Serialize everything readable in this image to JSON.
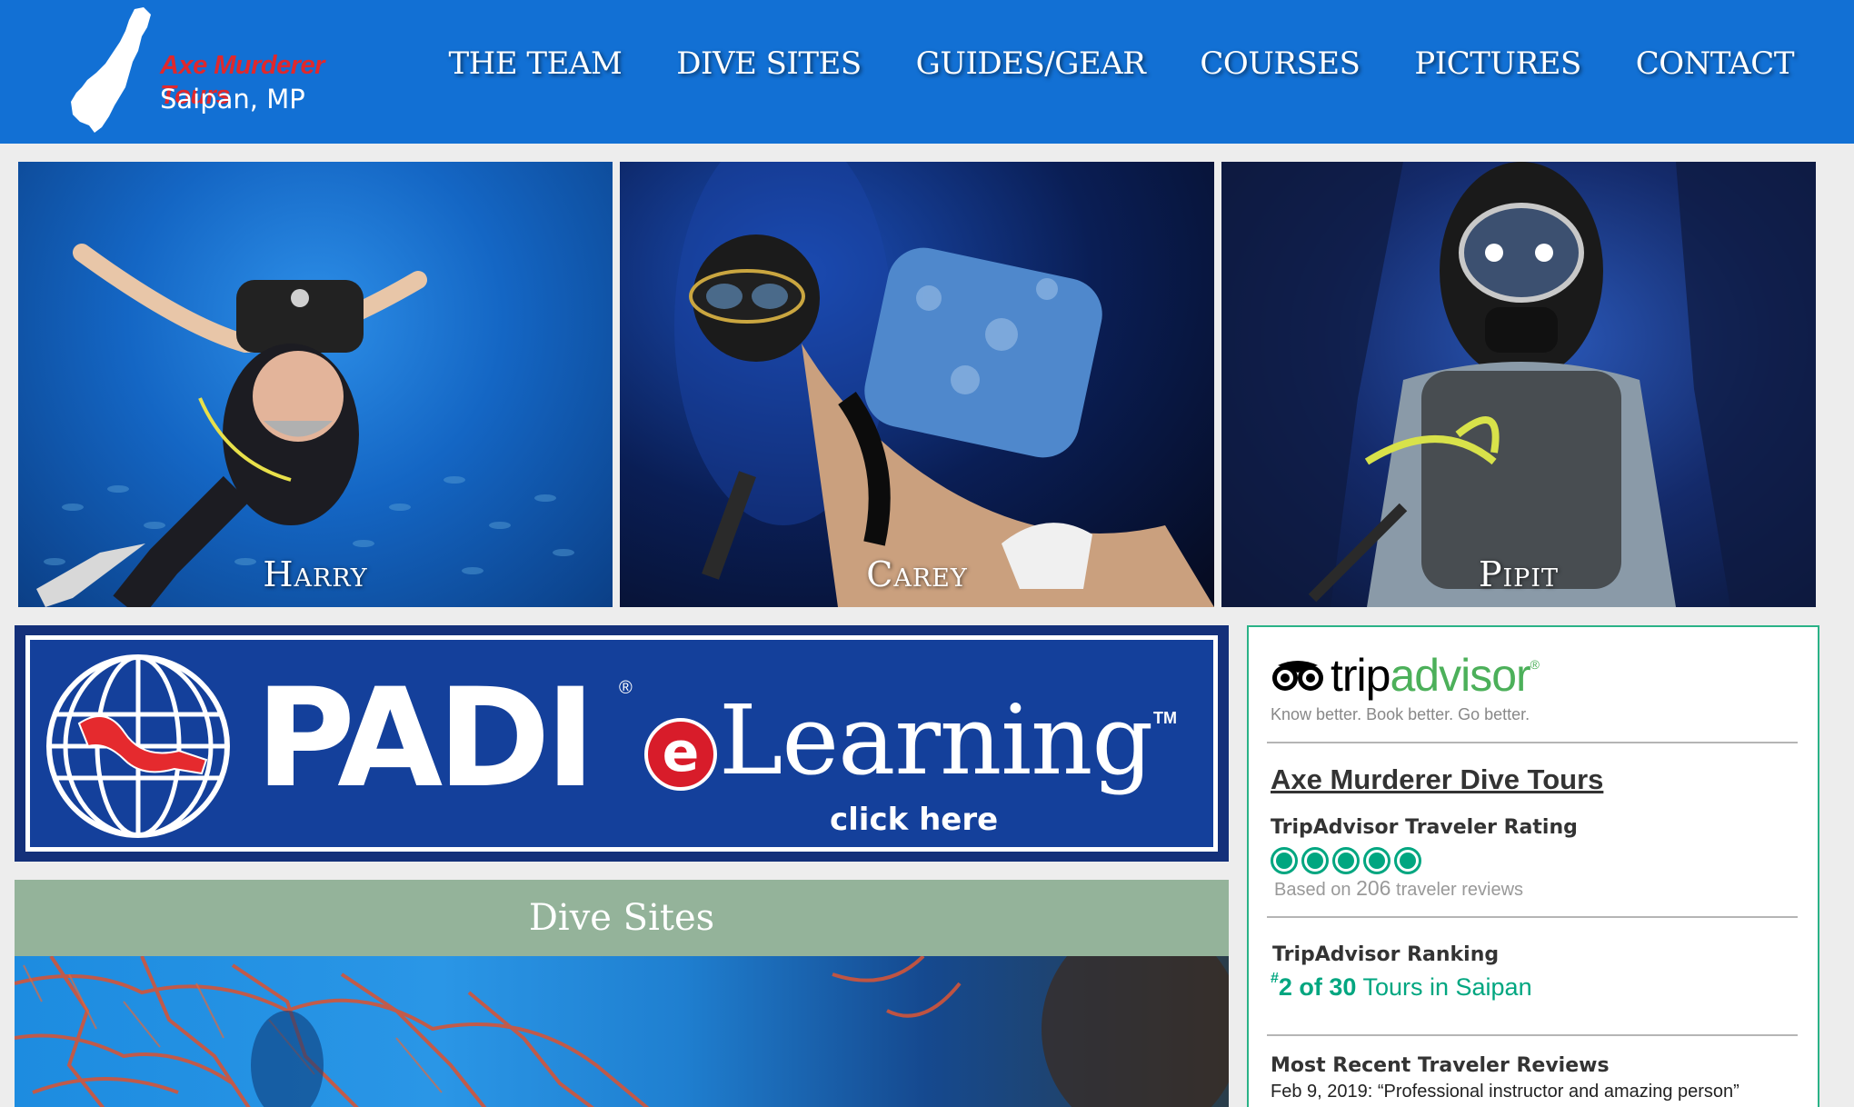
{
  "brand": {
    "name": "Axe Murderer Tours",
    "location": "Saipan, MP",
    "logo_icon": "saipan-island-icon"
  },
  "nav": {
    "items": [
      {
        "label": "THE TEAM"
      },
      {
        "label": "DIVE SITES"
      },
      {
        "label": "GUIDES/GEAR"
      },
      {
        "label": "COURSES"
      },
      {
        "label": "PICTURES"
      },
      {
        "label": "CONTACT"
      }
    ]
  },
  "team": [
    {
      "name": "Harry"
    },
    {
      "name": "Carey"
    },
    {
      "name": "Pipit"
    }
  ],
  "padi_banner": {
    "brand": "PADI",
    "registered": "®",
    "e_letter": "e",
    "product": "Learning",
    "trademark": "TM",
    "cta": "click here"
  },
  "dive_sites": {
    "title": "Dive Sites"
  },
  "tripadvisor": {
    "wordmark_trip": "trip",
    "wordmark_advisor": "advisor",
    "registered": "®",
    "tagline": "Know better. Book better. Go better.",
    "business_name": "Axe Murderer Dive Tours",
    "rating_label": "TripAdvisor Traveler Rating",
    "rating": 5,
    "rating_max": 5,
    "reviews_prefix": "Based on",
    "reviews_count": "206",
    "reviews_suffix": "traveler reviews",
    "ranking_label": "TripAdvisor Ranking",
    "ranking_hash": "#",
    "ranking_value": "2 of 30",
    "ranking_suffix": "Tours in Saipan",
    "recent_label": "Most Recent Traveler Reviews",
    "recent_review": "Feb 9, 2019: “Professional instructor and amazing person”"
  },
  "colors": {
    "header_bg": "#1270d4",
    "logo_red": "#e0282c",
    "page_bg": "#ededed",
    "dive_header_bg": "#94b39a",
    "ta_green": "#00a680",
    "ta_border": "#2bb287",
    "padi_blue": "#14409b"
  }
}
